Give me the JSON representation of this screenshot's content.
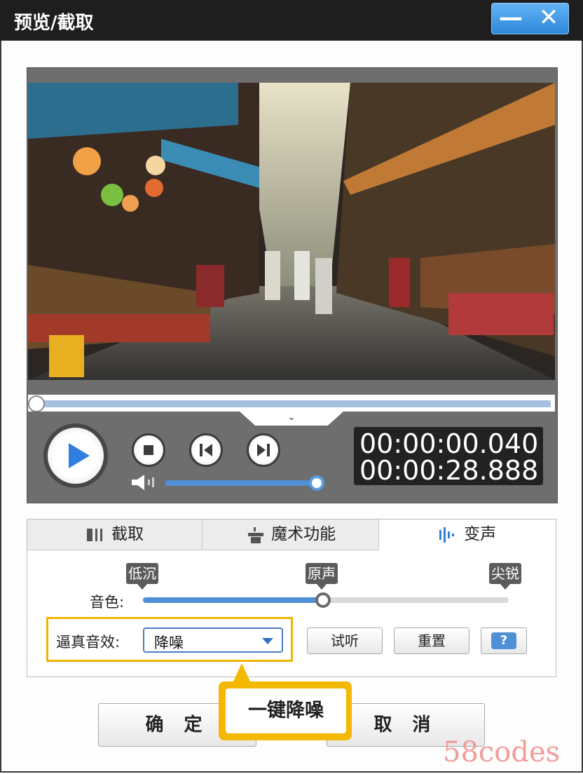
{
  "window": {
    "title": "预览/截取",
    "minimize_label": "—",
    "close_label": "✕",
    "accent": "#3a8ee6"
  },
  "player": {
    "expand_icon": "⌄",
    "current_time": "00:00:00.040",
    "total_time": "00:00:28.888"
  },
  "tabs": [
    {
      "label": "截取",
      "icon": "crop-icon"
    },
    {
      "label": "魔术功能",
      "icon": "magic-hat-icon"
    },
    {
      "label": "变声",
      "icon": "waveform-icon"
    }
  ],
  "voice": {
    "markers": {
      "low": "低沉",
      "original": "原声",
      "sharp": "尖锐"
    },
    "timbre_label": "音色:",
    "timbre_value_fraction": 0.5,
    "effect_label": "逼真音效:",
    "effect_value": "降噪",
    "listen_button": "试听",
    "reset_button": "重置"
  },
  "footer": {
    "ok_button": "确 定",
    "cancel_button": "取 消"
  },
  "callout": {
    "text": "一键降噪"
  },
  "watermark": {
    "text": "58codes"
  }
}
